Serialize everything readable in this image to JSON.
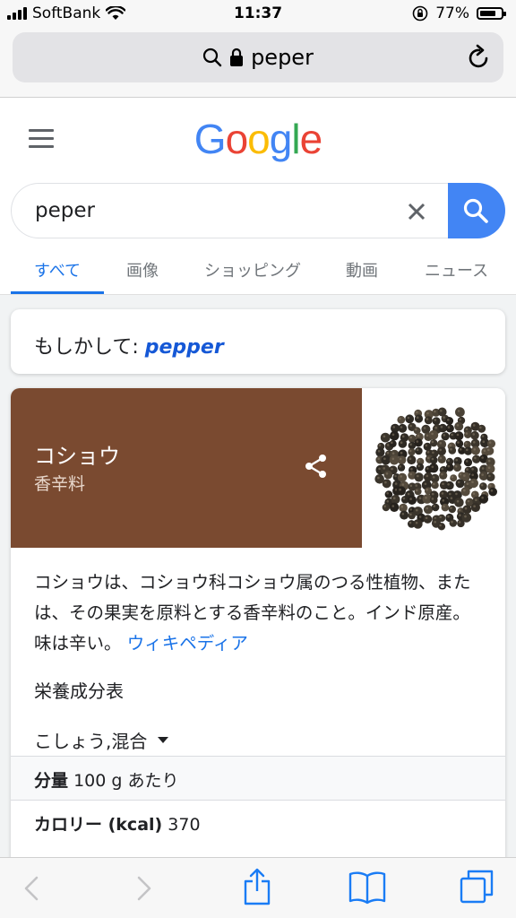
{
  "status_bar": {
    "carrier": "SoftBank",
    "time": "11:37",
    "battery_percent": "77%",
    "battery_level": 0.77
  },
  "browser": {
    "url_text": "peper"
  },
  "google": {
    "logo_letters": [
      "G",
      "o",
      "o",
      "g",
      "l",
      "e"
    ],
    "logo_colors": [
      "#4285f4",
      "#ea4335",
      "#fbbc05",
      "#4285f4",
      "#34a853",
      "#ea4335"
    ],
    "search_query": "peper",
    "tabs": [
      {
        "label": "すべて",
        "active": true
      },
      {
        "label": "画像",
        "active": false
      },
      {
        "label": "ショッピング",
        "active": false
      },
      {
        "label": "動画",
        "active": false
      },
      {
        "label": "ニュース",
        "active": false
      }
    ],
    "did_you_mean": {
      "prefix": "もしかして: ",
      "suggestion": "pepper"
    }
  },
  "knowledge_panel": {
    "title": "コショウ",
    "subtitle": "香辛料",
    "header_color": "#7a4a30",
    "description": "コショウは、コショウ科コショウ属のつる性植物、または、その果実を原料とする香辛料のこと。インド原産。味は辛い。",
    "source_link": "ウィキペディア",
    "nutrition_title": "栄養成分表",
    "nutrition_item": "こしょう,混合",
    "rows": [
      {
        "key": "分量",
        "value": "100 g あたり"
      },
      {
        "key": "カロリー (kcal)",
        "value": "370"
      }
    ]
  },
  "colors": {
    "accent_blue": "#1a73e8",
    "search_button": "#4285f4"
  }
}
